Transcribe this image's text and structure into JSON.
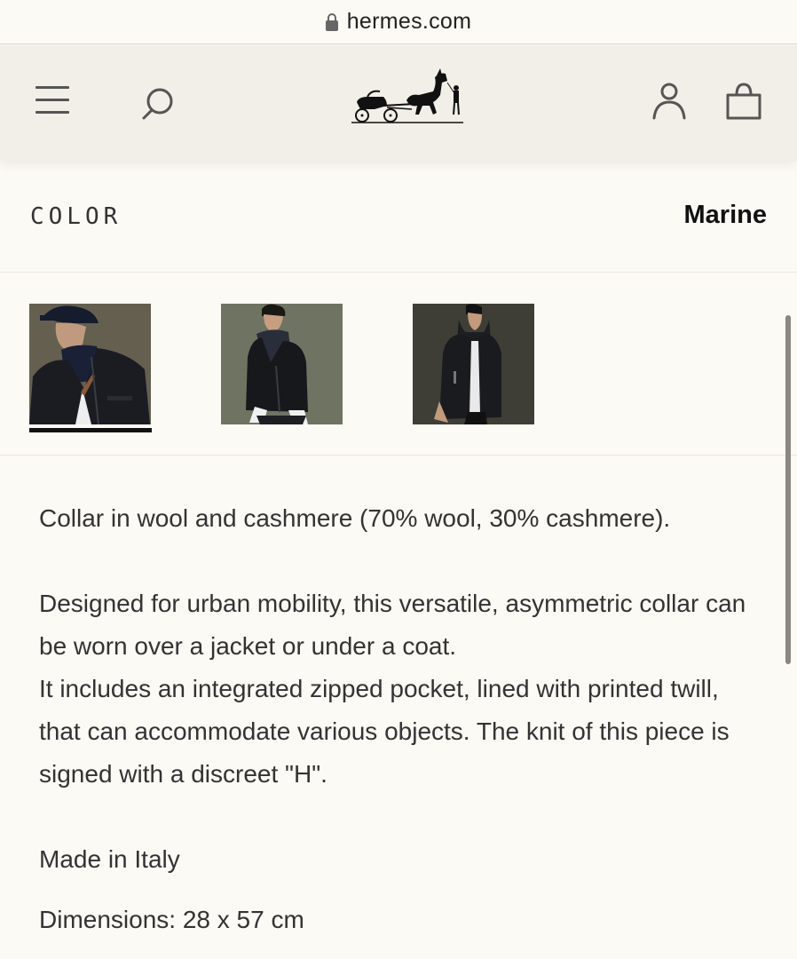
{
  "browser": {
    "domain": "hermes.com"
  },
  "header": {
    "menu_icon": "menu-icon",
    "search_icon": "search-icon",
    "logo": "hermes-carriage-logo",
    "account_icon": "account-icon",
    "bag_icon": "shopping-bag-icon"
  },
  "color": {
    "label": "COLOR",
    "value": "Marine"
  },
  "thumbnails": [
    {
      "name": "thumb-look-1",
      "selected": true
    },
    {
      "name": "thumb-look-2",
      "selected": false
    },
    {
      "name": "thumb-look-3",
      "selected": false
    }
  ],
  "description": {
    "line1": "Collar in wool and cashmere (70% wool, 30% cashmere).",
    "para2a": "Designed for urban mobility, this versatile, asymmetric collar can be worn over a jacket or under a coat.",
    "para2b": "It includes an integrated zipped pocket, lined with printed twill, that can accommodate various objects. The knit of this piece is signed with a discreet \"H\".",
    "made_in": "Made in Italy",
    "dimensions": "Dimensions: 28 x 57 cm"
  },
  "colors": {
    "background": "#fcfaf4",
    "header": "#f2efe8",
    "text": "#333333"
  }
}
